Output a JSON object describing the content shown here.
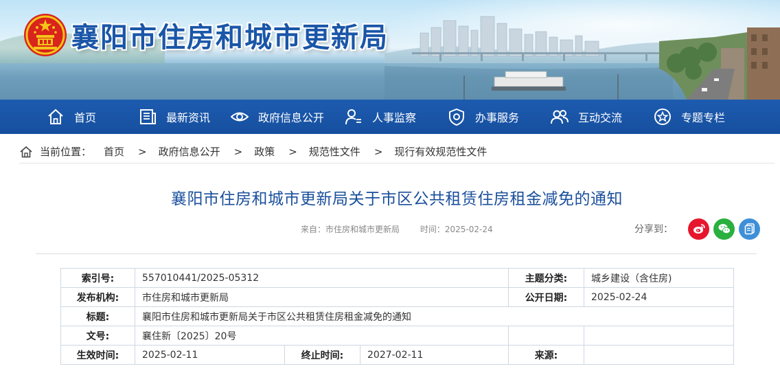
{
  "site": {
    "title": "襄阳市住房和城市更新局"
  },
  "nav": {
    "items": [
      {
        "label": "首页",
        "icon": "home-icon"
      },
      {
        "label": "最新资讯",
        "icon": "news-icon"
      },
      {
        "label": "政府信息公开",
        "icon": "eye-icon"
      },
      {
        "label": "人事监察",
        "icon": "person-icon"
      },
      {
        "label": "办事服务",
        "icon": "shield-icon"
      },
      {
        "label": "互动交流",
        "icon": "people-icon"
      },
      {
        "label": "专题专栏",
        "icon": "star-icon"
      }
    ]
  },
  "breadcrumb": {
    "label": "当前位置：",
    "separator": ">",
    "items": [
      "首页",
      "政府信息公开",
      "政策",
      "规范性文件",
      "现行有效规范性文件"
    ]
  },
  "article": {
    "title": "襄阳市住房和城市更新局关于市区公共租赁住房租金减免的通知",
    "source": "来自：市住房和城市更新局",
    "time": "时间：2025-02-24"
  },
  "share": {
    "label": "分享到：",
    "buttons": [
      {
        "icon": "weibo-icon",
        "color": "#e6162d"
      },
      {
        "icon": "wechat-icon",
        "color": "#2ab03f"
      },
      {
        "icon": "copy-icon",
        "color": "#3f8fd8"
      }
    ]
  },
  "info": {
    "index_label": "索引号:",
    "index_value": "557010441/2025-05312",
    "topic_label": "主题分类:",
    "topic_value": "城乡建设（含住房)",
    "publisher_label": "发布机构:",
    "publisher_value": "市住房和城市更新局",
    "date_label": "公开日期:",
    "date_value": "2025-02-24",
    "title_label": "标题:",
    "title_value": "襄阳市住房和城市更新局关于市区公共租赁住房租金减免的通知",
    "docno_label": "文号:",
    "docno_value": "襄住新〔2025〕20号",
    "effective_label": "生效时间:",
    "effective_value": "2025-02-11",
    "expire_label": "终止时间:",
    "expire_value": "2027-02-11",
    "origin_label": "来源:",
    "origin_value": ""
  }
}
